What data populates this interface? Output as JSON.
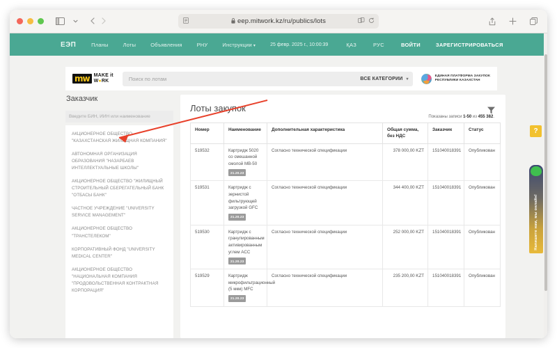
{
  "browser": {
    "url": "eep.mitwork.kz/ru/publics/lots",
    "lock_icon": "lock-icon",
    "reader_icon": "reader-view-icon",
    "sidebar_icon": "sidebar-toggle-icon",
    "back_icon": "back-arrow-icon",
    "forward_icon": "forward-arrow-icon",
    "share_icon": "share-icon",
    "newtab_icon": "new-tab-icon",
    "tabs_icon": "tab-overview-icon",
    "extensions_icon": "extensions-icon",
    "reload_icon": "reload-icon"
  },
  "site_nav": {
    "brand": "ЕЭП",
    "links": [
      {
        "label": "Планы",
        "has_caret": false
      },
      {
        "label": "Лоты",
        "has_caret": false
      },
      {
        "label": "Объявления",
        "has_caret": false
      },
      {
        "label": "РНУ",
        "has_caret": false
      },
      {
        "label": "Инструкции",
        "has_caret": true
      }
    ],
    "datetime": "25 февр. 2025 г., 10:00:39",
    "lang_kz": "ҚАЗ",
    "lang_ru": "РУС",
    "login": "ВОЙТИ",
    "register": "ЗАРЕГИСТРИРОВАТЬСЯ"
  },
  "header": {
    "logo_mark": "mw",
    "logo_line1": "MAKE it",
    "logo_line2": "W",
    "logo_line2b": "RK",
    "search_placeholder": "Поиск по лотам",
    "search_value": "",
    "category_label": "ВСЕ КАТЕГОРИИ",
    "platform_line1": "ЕДИНАЯ ПЛАТФОРМА ЗАКУПОК",
    "platform_line2": "РЕСПУБЛИКИ КАЗАХСТАН"
  },
  "left_panel": {
    "title": "Заказчик",
    "bin_placeholder": "Введите БИН, ИИН или наименование",
    "bin_value": "",
    "organizations": [
      "АКЦИОНЕРНОЕ ОБЩЕСТВО \"КАЗАХСТАНСКАЯ ЖИЛИЩНАЯ КОМПАНИЯ\"",
      "АВТОНОМНАЯ ОРГАНИЗАЦИЯ ОБРАЗОВАНИЯ \"НАЗАРБАЕВ ИНТЕЛЛЕКТУАЛЬНЫЕ ШКОЛЫ\"",
      "АКЦИОНЕРНОЕ ОБЩЕСТВО \"ЖИЛИЩНЫЙ СТРОИТЕЛЬНЫЙ СБЕРЕГАТЕЛЬНЫЙ БАНК \"ОТБАСЫ БАНК\"",
      "ЧАСТНОЕ УЧРЕЖДЕНИЕ \"UNIVERSITY SERVICE MANAGEMENT\"",
      "АКЦИОНЕРНОЕ ОБЩЕСТВО \"ТРАНСТЕЛЕКОМ\"",
      "КОРПОРАТИВНЫЙ ФОНД \"UNIVERSITY MEDICAL CENTER\"",
      "АКЦИОНЕРНОЕ ОБЩЕСТВО \"НАЦИОНАЛЬНАЯ КОМПАНИЯ \"ПРОДОВОЛЬСТВЕННАЯ КОНТРАКТНАЯ КОРПОРАЦИЯ\""
    ]
  },
  "main": {
    "title": "Лоты закупок",
    "filter_icon": "filter-icon",
    "records_prefix": "Показаны записи ",
    "records_range": "1-50",
    "records_mid": " из ",
    "records_total": "455 382",
    "records_suffix": ".",
    "columns": [
      "Номер",
      "Наименование",
      "Дополнительная характеристика",
      "Общая сумма, без НДС",
      "Заказчик",
      "Статус"
    ],
    "rows": [
      {
        "number": "519532",
        "name": "Картридж 5020 со смешанной смолой МВ-50",
        "code": "21.20.23",
        "characteristic": "Согласно технической спецификации",
        "sum": "378 000,00 KZT",
        "customer": "151040018391",
        "status": "Опубликован"
      },
      {
        "number": "519531",
        "name": "Картридж с зернистой фильтрующей загрузкой GFC",
        "code": "21.20.23",
        "characteristic": "Согласно технической спецификации",
        "sum": "344 400,00 KZT",
        "customer": "151040018391",
        "status": "Опубликован"
      },
      {
        "number": "519530",
        "name": "Картридж с гранулированным активированным углем ACC",
        "code": "21.20.23",
        "characteristic": "Согласно технической спецификации",
        "sum": "252 000,00 KZT",
        "customer": "151040018391",
        "status": "Опубликован"
      },
      {
        "number": "519529",
        "name": "Картридж микрофильтрационный (5 мкм) MFC",
        "code": "21.20.23",
        "characteristic": "Согласно технической спецификации",
        "sum": "235 200,00 KZT",
        "customer": "151040018391",
        "status": "Опубликован"
      }
    ]
  },
  "widgets": {
    "help_label": "?",
    "chat_label": "Напишите нам, мы онлайн!"
  },
  "colors": {
    "nav_teal": "#4aa893",
    "accent_yellow": "#f2c12e",
    "page_bg": "#f2f2f0",
    "annotation_red": "#e8412b"
  }
}
